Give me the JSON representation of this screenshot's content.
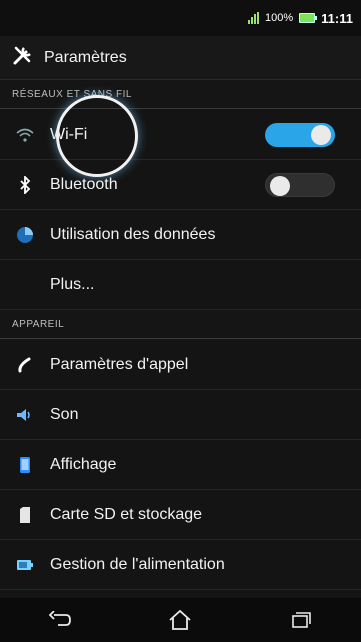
{
  "status": {
    "battery": "100%",
    "time": "11:11"
  },
  "header": {
    "title": "Paramètres"
  },
  "sections": {
    "network": "RÉSEAUX ET SANS FIL",
    "device": "APPAREIL"
  },
  "items": {
    "wifi": {
      "label": "Wi-Fi",
      "enabled": true
    },
    "bluetooth": {
      "label": "Bluetooth",
      "enabled": false
    },
    "data_usage": {
      "label": "Utilisation des données"
    },
    "more": {
      "label": "Plus..."
    },
    "call_settings": {
      "label": "Paramètres d'appel"
    },
    "sound": {
      "label": "Son"
    },
    "display": {
      "label": "Affichage"
    },
    "storage": {
      "label": "Carte SD et stockage"
    },
    "power": {
      "label": "Gestion de l'alimentation"
    }
  },
  "colors": {
    "accent": "#2aa6e8",
    "background": "#141414"
  }
}
